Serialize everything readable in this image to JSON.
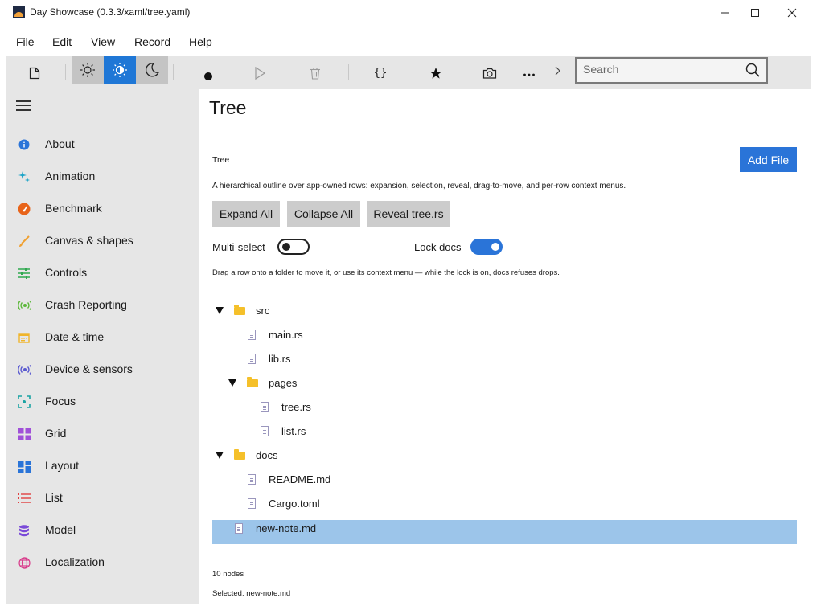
{
  "window": {
    "title": "Day Showcase (0.3.3/xaml/tree.yaml)"
  },
  "menu": [
    "File",
    "Edit",
    "View",
    "Record",
    "Help"
  ],
  "toolbar": {
    "icons": [
      "new-file-icon",
      "light-theme-icon",
      "auto-theme-icon",
      "dark-theme-icon",
      "record-icon",
      "play-icon",
      "trash-icon",
      "braces-icon",
      "star-icon",
      "camera-icon",
      "more-icon",
      "chevron-right-icon"
    ],
    "active_theme": "auto",
    "accent": "#1f77d6"
  },
  "search": {
    "placeholder": "Search",
    "value": ""
  },
  "sidebar": {
    "items": [
      {
        "label": "About",
        "icon": "info-icon",
        "color": "#2a74d8"
      },
      {
        "label": "Animation",
        "icon": "sparkle-icon",
        "color": "#1aa3c7"
      },
      {
        "label": "Benchmark",
        "icon": "gauge-icon",
        "color": "#e8641a"
      },
      {
        "label": "Canvas & shapes",
        "icon": "brush-icon",
        "color": "#f0a030"
      },
      {
        "label": "Controls",
        "icon": "sliders-icon",
        "color": "#2fa84f"
      },
      {
        "label": "Crash Reporting",
        "icon": "broadcast-icon",
        "color": "#5cb83a"
      },
      {
        "label": "Date & time",
        "icon": "calendar-icon",
        "color": "#f0b429"
      },
      {
        "label": "Device & sensors",
        "icon": "sensor-icon",
        "color": "#5a5ad0"
      },
      {
        "label": "Focus",
        "icon": "focus-icon",
        "color": "#1aa3a3"
      },
      {
        "label": "Grid",
        "icon": "grid-icon",
        "color": "#a050d8"
      },
      {
        "label": "Layout",
        "icon": "layout-icon",
        "color": "#2a74d8"
      },
      {
        "label": "List",
        "icon": "list-icon",
        "color": "#e04040"
      },
      {
        "label": "Model",
        "icon": "database-icon",
        "color": "#7a4ad8"
      },
      {
        "label": "Localization",
        "icon": "globe-icon",
        "color": "#d83a8a"
      }
    ]
  },
  "page": {
    "title": "Tree",
    "section_title": "Tree",
    "add_file": "Add File",
    "description": "A hierarchical outline over app-owned rows: expansion, selection, reveal, drag-to-move, and per-row context menus.",
    "buttons": [
      "Expand All",
      "Collapse All",
      "Reveal tree.rs"
    ],
    "multi_select": {
      "label": "Multi-select",
      "on": false
    },
    "lock_docs": {
      "label": "Lock docs",
      "on": true
    },
    "hint": "Drag a row onto a folder to move it, or use its context menu — while the lock is on, docs refuses drops.",
    "tree": [
      {
        "label": "src",
        "type": "folder",
        "depth": 0,
        "expanded": true
      },
      {
        "label": "main.rs",
        "type": "file",
        "depth": 1
      },
      {
        "label": "lib.rs",
        "type": "file",
        "depth": 1
      },
      {
        "label": "pages",
        "type": "folder",
        "depth": 1,
        "expanded": true
      },
      {
        "label": "tree.rs",
        "type": "file",
        "depth": 2
      },
      {
        "label": "list.rs",
        "type": "file",
        "depth": 2
      },
      {
        "label": "docs",
        "type": "folder",
        "depth": 0,
        "expanded": true
      },
      {
        "label": "README.md",
        "type": "file",
        "depth": 1
      },
      {
        "label": "Cargo.toml",
        "type": "file",
        "depth": 1
      },
      {
        "label": "new-note.md",
        "type": "file",
        "depth": 0,
        "selected": true
      }
    ],
    "node_count": "10 nodes",
    "selected": "Selected: new-note.md"
  }
}
